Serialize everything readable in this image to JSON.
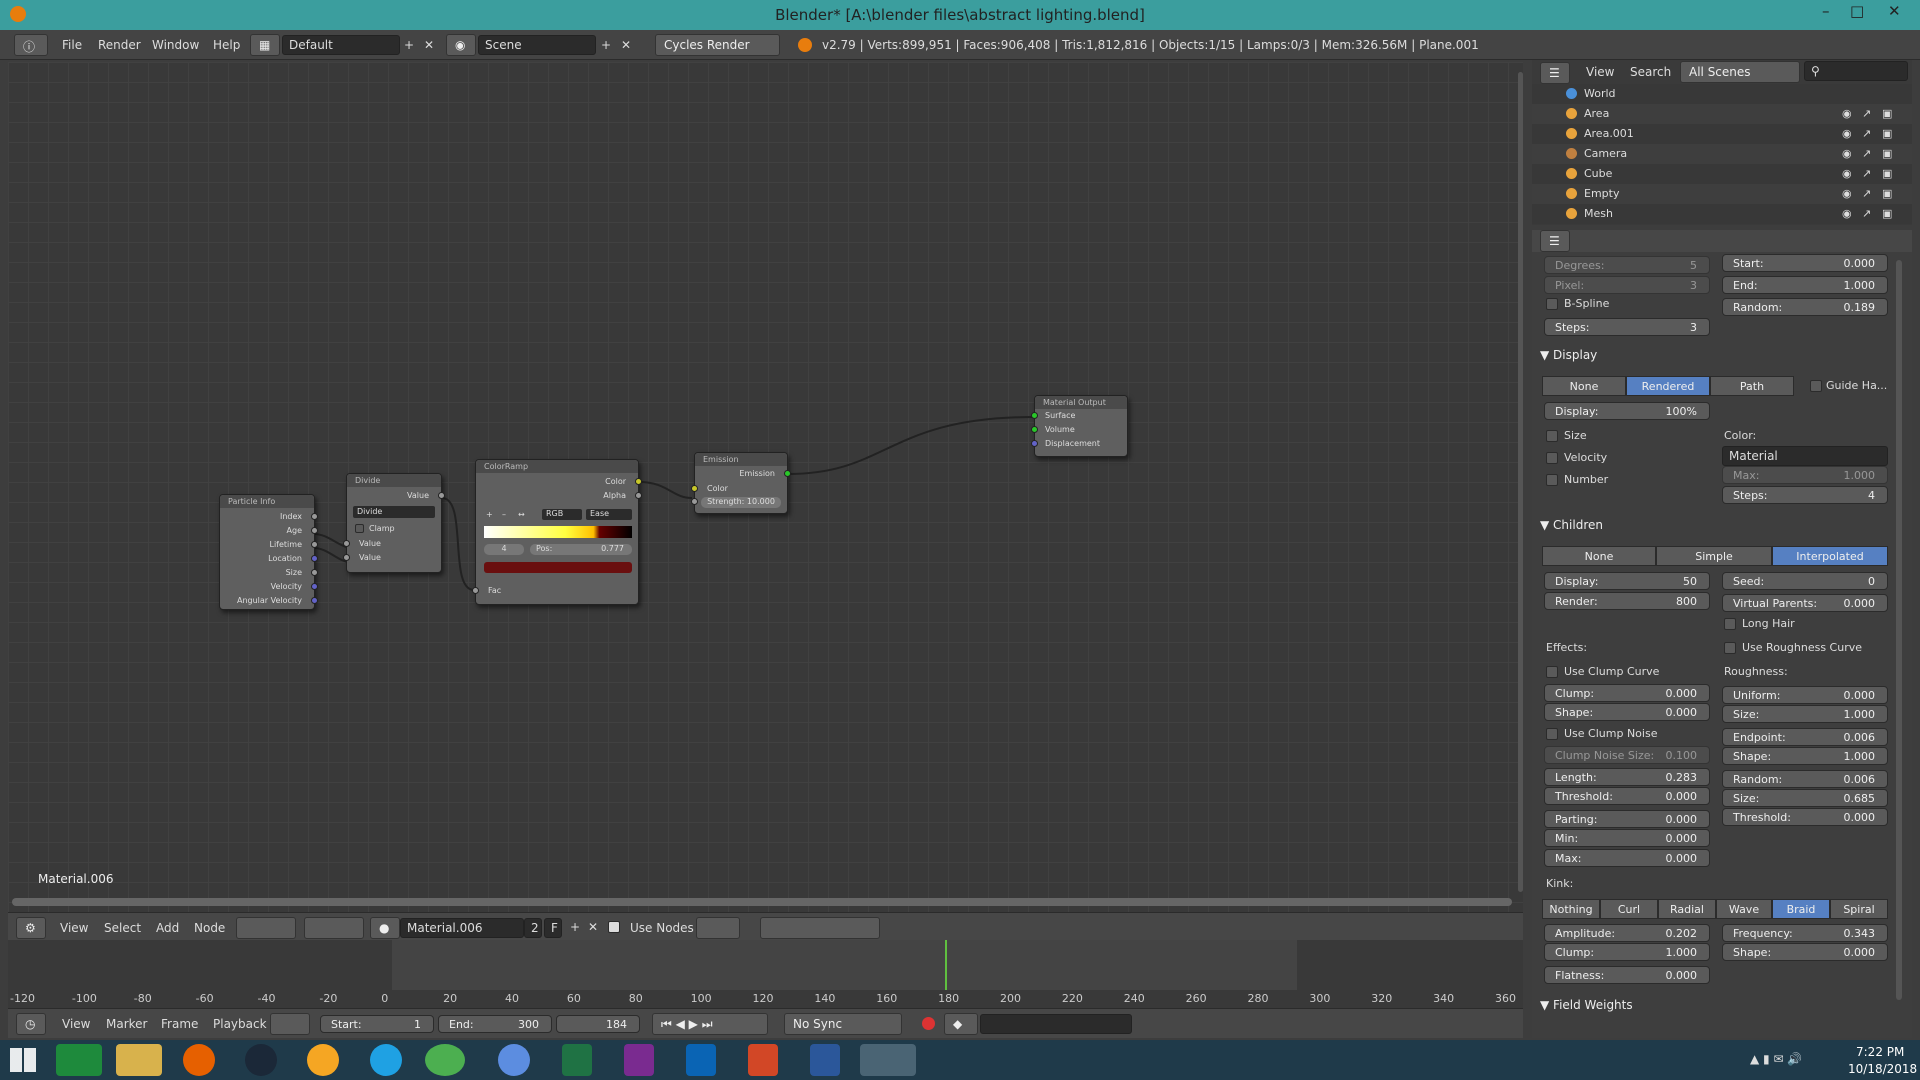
{
  "window": {
    "title": "Blender* [A:\\blender files\\abstract lighting.blend]"
  },
  "menu": {
    "file": "File",
    "render": "Render",
    "window": "Window",
    "help": "Help",
    "layout": "Default",
    "scene": "Scene",
    "engine": "Cycles Render",
    "stats": "v2.79 | Verts:899,951 | Faces:906,408 | Tris:1,812,816 | Objects:1/15 | Lamps:0/3 | Mem:326.56M | Plane.001"
  },
  "nodes": {
    "particle": {
      "title": "Particle Info",
      "outs": [
        "Index",
        "Age",
        "Lifetime",
        "Location",
        "Size",
        "Velocity",
        "Angular Velocity"
      ]
    },
    "divide": {
      "title": "Divide",
      "out": "Value",
      "op": "Divide",
      "clamp": "Clamp",
      "in1": "Value",
      "in2": "Value"
    },
    "ramp": {
      "title": "ColorRamp",
      "out1": "Color",
      "out2": "Alpha",
      "mode": "RGB",
      "interp": "Ease",
      "index": "4",
      "pos_label": "Pos:",
      "pos_val": "0.777",
      "fac": "Fac"
    },
    "emission": {
      "title": "Emission",
      "out": "Emission",
      "color": "Color",
      "strength": "Strength: 10.000"
    },
    "output": {
      "title": "Material Output",
      "surface": "Surface",
      "volume": "Volume",
      "displacement": "Displacement"
    }
  },
  "material_label": "Material.006",
  "nodehdr": {
    "view": "View",
    "select": "Select",
    "add": "Add",
    "node": "Node",
    "material": "Material.006",
    "users": "2",
    "fake": "F",
    "use_nodes": "Use Nodes"
  },
  "timeline": {
    "ticks": [
      "-120",
      "-100",
      "-80",
      "-60",
      "-40",
      "-20",
      "0",
      "20",
      "40",
      "60",
      "80",
      "100",
      "120",
      "140",
      "160",
      "180",
      "200",
      "220",
      "240",
      "260",
      "280",
      "300",
      "320",
      "340",
      "360"
    ],
    "current_frame": 184
  },
  "tlhdr": {
    "view": "View",
    "marker": "Marker",
    "frame": "Frame",
    "playback": "Playback",
    "start_label": "Start:",
    "start": "1",
    "end_label": "End:",
    "end": "300",
    "frame_cur": "184",
    "sync": "No Sync"
  },
  "outliner": {
    "view": "View",
    "search": "Search",
    "scenes": "All Scenes",
    "items": [
      "World",
      "Area",
      "Area.001",
      "Camera",
      "Cube",
      "Empty",
      "Mesh"
    ]
  },
  "props": {
    "degrees": "Degrees:",
    "degrees_v": "5",
    "pixel": "Pixel:",
    "pixel_v": "3",
    "bspline": "B-Spline",
    "steps": "Steps:",
    "steps_v": "3",
    "start": "Start:",
    "start_v": "0.000",
    "end": "End:",
    "end_v": "1.000",
    "random": "Random:",
    "random_v": "0.189",
    "display_title": "Display",
    "d_none": "None",
    "d_rendered": "Rendered",
    "d_path": "Path",
    "guide": "Guide Ha...",
    "display": "Display:",
    "display_v": "100%",
    "size": "Size",
    "velocity": "Velocity",
    "number": "Number",
    "color_label": "Color:",
    "color_sel": "Material",
    "max": "Max:",
    "max_v": "1.000",
    "steps2": "Steps:",
    "steps2_v": "4",
    "children_title": "Children",
    "c_none": "None",
    "c_simple": "Simple",
    "c_interp": "Interpolated",
    "c_display": "Display:",
    "c_display_v": "50",
    "c_render": "Render:",
    "c_render_v": "800",
    "seed": "Seed:",
    "seed_v": "0",
    "vparents": "Virtual Parents:",
    "vparents_v": "0.000",
    "long_hair": "Long Hair",
    "use_rough": "Use Roughness Curve",
    "effects": "Effects:",
    "roughness": "Roughness:",
    "use_clump": "Use Clump Curve",
    "clump": "Clump:",
    "clump_v": "0.000",
    "shape": "Shape:",
    "shape_v": "0.000",
    "uniform": "Uniform:",
    "uniform_v": "0.000",
    "rsize": "Size:",
    "rsize_v": "1.000",
    "use_clump_noise": "Use Clump Noise",
    "clump_noise_size": "Clump Noise Size:",
    "clump_noise_size_v": "0.100",
    "endpoint": "Endpoint:",
    "endpoint_v": "0.006",
    "eshape": "Shape:",
    "eshape_v": "1.000",
    "length": "Length:",
    "length_v": "0.283",
    "threshold": "Threshold:",
    "threshold_v": "0.000",
    "rrandom": "Random:",
    "rrandom_v": "0.006",
    "rsize2": "Size:",
    "rsize2_v": "0.685",
    "rthreshold": "Threshold:",
    "rthreshold_v": "0.000",
    "parting": "Parting:",
    "parting_v": "0.000",
    "min": "Min:",
    "min_v": "0.000",
    "pmax": "Max:",
    "pmax_v": "0.000",
    "kink": "Kink:",
    "k_nothing": "Nothing",
    "k_curl": "Curl",
    "k_radial": "Radial",
    "k_wave": "Wave",
    "k_braid": "Braid",
    "k_spiral": "Spiral",
    "amplitude": "Amplitude:",
    "amplitude_v": "0.202",
    "kclump": "Clump:",
    "kclump_v": "1.000",
    "flatness": "Flatness:",
    "flatness_v": "0.000",
    "frequency": "Frequency:",
    "frequency_v": "0.343",
    "kshape": "Shape:",
    "kshape_v": "0.000",
    "field_weights": "Field Weights"
  },
  "taskbar": {
    "time": "7:22 PM",
    "date": "10/18/2018"
  },
  "colors": {
    "accent": "#5680c2",
    "title": "#3b9e9e"
  }
}
